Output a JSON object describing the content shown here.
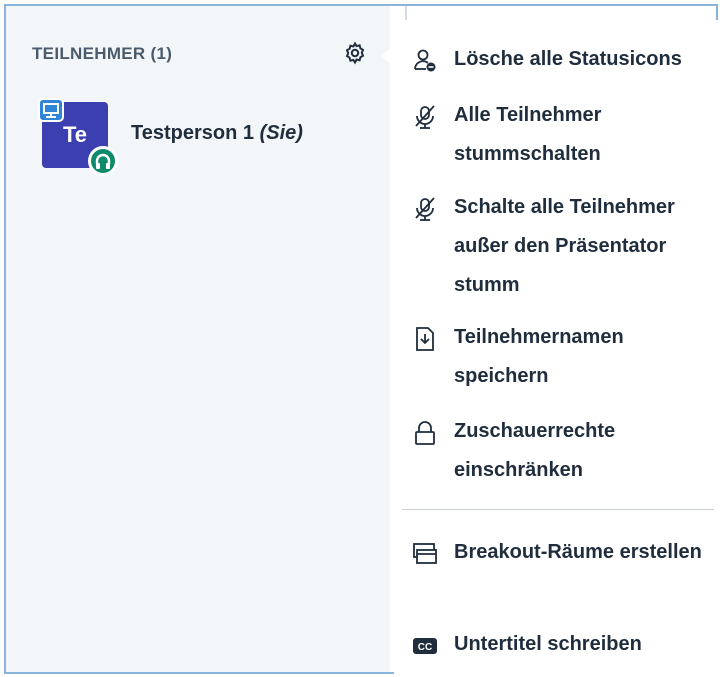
{
  "participants": {
    "title": "TEILNEHMER (1)",
    "list": [
      {
        "initials": "Te",
        "name": "Testperson 1",
        "suffix": "(Sie)",
        "avatar_color": "#3b3fb0",
        "audio_badge_color": "#0f8a6a",
        "presenter_badge_color": "#2f86d6"
      }
    ]
  },
  "settings_menu": {
    "items": [
      {
        "icon": "user-clear-status-icon",
        "label": "Lösche alle Statusicons"
      },
      {
        "icon": "mic-off-icon",
        "label": "Alle Teilnehmer stummschalten"
      },
      {
        "icon": "mic-off-icon",
        "label": "Schalte alle Teilnehmer außer den Präsentator stumm"
      },
      {
        "icon": "file-download-icon",
        "label": "Teilnehmernamen speichern"
      },
      {
        "icon": "lock-icon",
        "label": "Zuschauerrechte einschränken"
      },
      {
        "icon": "breakout-rooms-icon",
        "label": "Breakout-Räume erstellen"
      },
      {
        "icon": "closed-captions-icon",
        "label": "Untertitel schreiben"
      }
    ]
  },
  "colors": {
    "accent": "#2f86d6",
    "text": "#1f2d3d",
    "sidebar_bg": "#f3f6f9"
  }
}
